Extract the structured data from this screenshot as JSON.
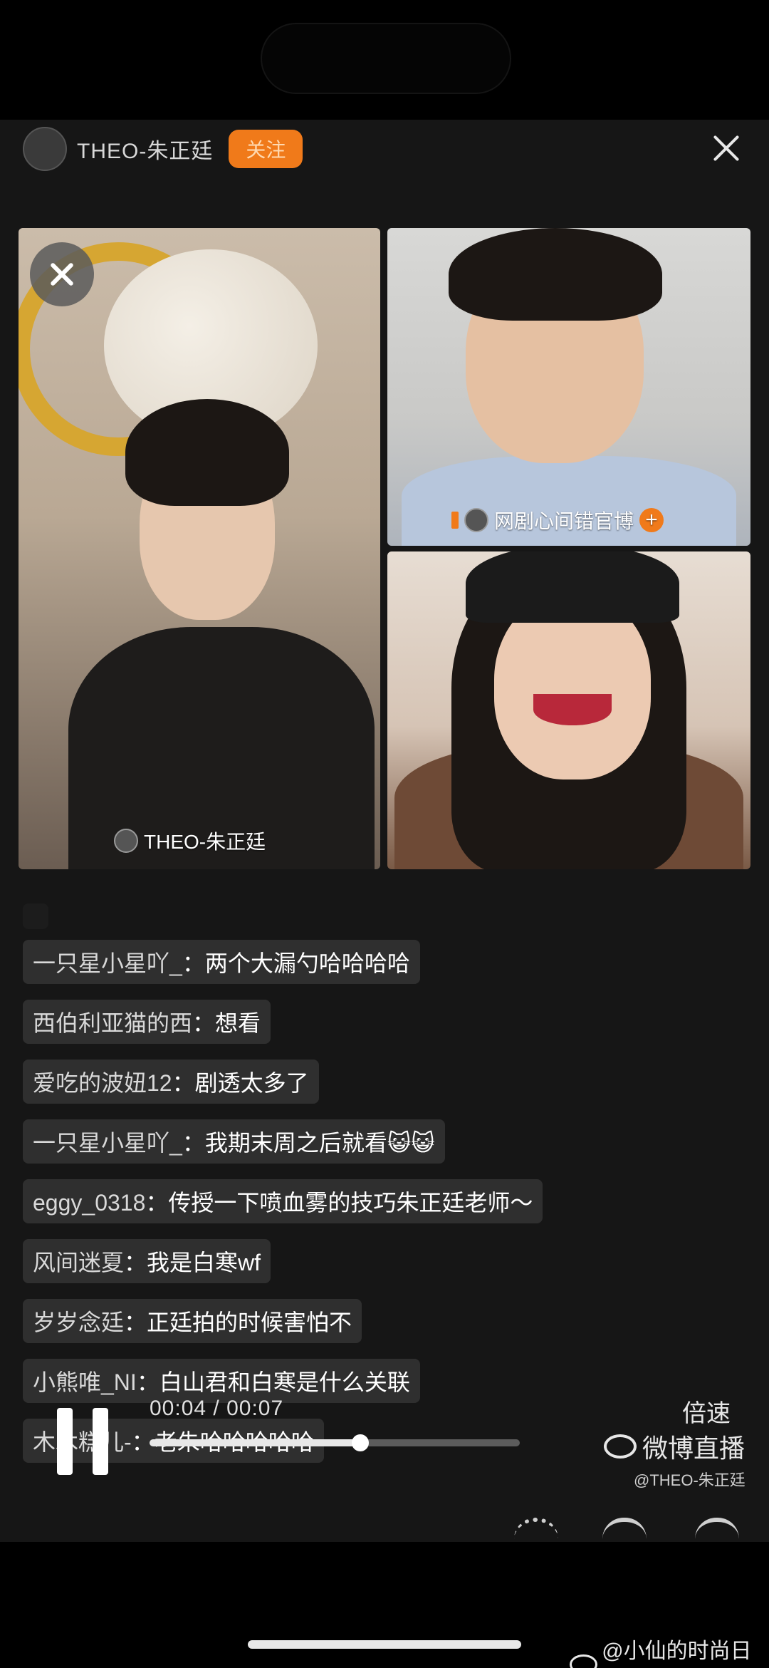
{
  "host": {
    "name": "THEO-朱正廷",
    "follow_label": "关注"
  },
  "tiles": {
    "main_label": "THEO-朱正廷",
    "guest1_label": "网剧心间错官博"
  },
  "comments": [
    {
      "user": "一只星小星吖_",
      "text": "两个大漏勺哈哈哈哈"
    },
    {
      "user": "西伯利亚猫的西",
      "text": "想看"
    },
    {
      "user": "爱吃的波妞12",
      "text": "剧透太多了"
    },
    {
      "user": "一只星小星吖_",
      "text": "我期末周之后就看😺😺"
    },
    {
      "user": "eggy_0318",
      "text": "传授一下喷血雾的技巧朱正廷老师～"
    },
    {
      "user": "风间迷夏",
      "text": "我是白寒wf"
    },
    {
      "user": "岁岁念廷",
      "text": "正廷拍的时候害怕不"
    },
    {
      "user": "小熊唯_NI",
      "text": "白山君和白寒是什么关联"
    },
    {
      "user": "木木糕儿-",
      "text": "老朱哈哈哈哈哈"
    }
  ],
  "player": {
    "time": "00:04 / 00:07",
    "speed_label": "倍速",
    "progress": 0.57
  },
  "watermark": {
    "live": "微博直播",
    "handle": "@THEO-朱正廷",
    "account": "@小仙的时尚日志"
  }
}
